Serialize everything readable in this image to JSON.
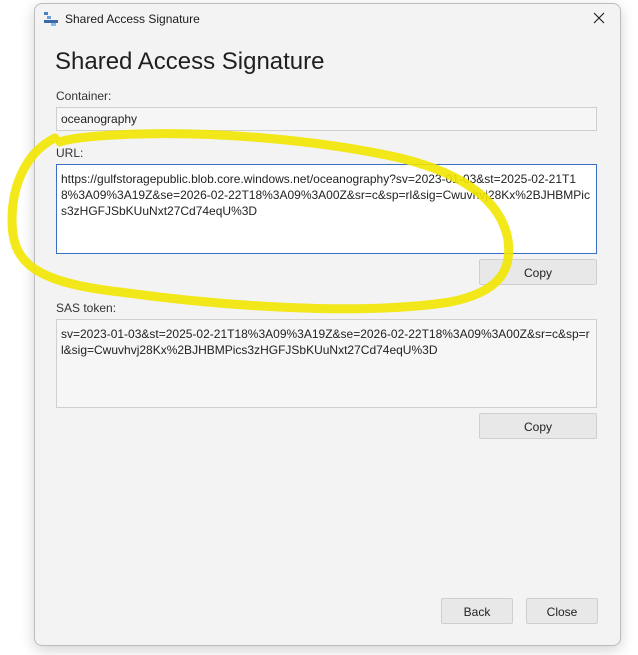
{
  "window": {
    "title": "Shared Access Signature",
    "heading": "Shared Access Signature"
  },
  "container": {
    "label": "Container:",
    "value": "oceanography"
  },
  "url": {
    "label": "URL:",
    "value": "https://gulfstoragepublic.blob.core.windows.net/oceanography?sv=2023-01-03&st=2025-02-21T18%3A09%3A19Z&se=2026-02-22T18%3A09%3A00Z&sr=c&sp=rl&sig=Cwuvhvj28Kx%2BJHBMPics3zHGFJSbKUuNxt27Cd74eqU%3D",
    "copy_label": "Copy"
  },
  "sas_token": {
    "label": "SAS token:",
    "value": "sv=2023-01-03&st=2025-02-21T18%3A09%3A19Z&se=2026-02-22T18%3A09%3A00Z&sr=c&sp=rl&sig=Cwuvhvj28Kx%2BJHBMPics3zHGFJSbKUuNxt27Cd74eqU%3D",
    "copy_label": "Copy"
  },
  "footer": {
    "back_label": "Back",
    "close_label": "Close"
  },
  "annotation": {
    "color": "#f2e600"
  }
}
